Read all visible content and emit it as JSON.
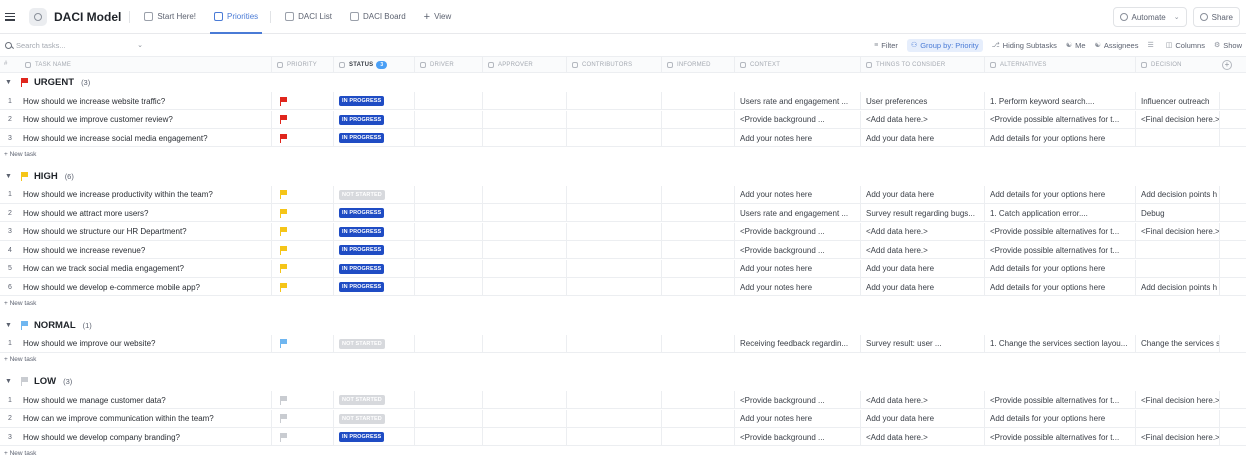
{
  "window": {
    "title": "DACI Model",
    "tabs": [
      {
        "label": "Start Here!",
        "active": false
      },
      {
        "label": "Priorities",
        "active": true
      },
      {
        "label": "DACI List",
        "active": false
      },
      {
        "label": "DACI Board",
        "active": false
      }
    ],
    "add_view": "View",
    "automate": "Automate",
    "share": "Share"
  },
  "toolbar": {
    "search_placeholder": "Search tasks...",
    "filter": "Filter",
    "group_by": "Group by: Priority",
    "hiding_subtasks": "Hiding Subtasks",
    "me": "Me",
    "assignees": "Assignees",
    "columns": "Columns",
    "show": "Show"
  },
  "columns": {
    "hash": "#",
    "task_name": "TASK NAME",
    "priority": "PRIORITY",
    "status": "STATUS",
    "status_count": "3",
    "driver": "DRIVER",
    "approver": "APPROVER",
    "contributors": "CONTRIBUTORS",
    "informed": "INFORMED",
    "context": "CONTEXT",
    "things": "THINGS TO CONSIDER",
    "alternatives": "ALTERNATIVES",
    "decision": "DECISION"
  },
  "colors": {
    "urgent": "#e0261d",
    "high": "#f5c518",
    "normal": "#6fb6f0",
    "low": "#c9ccd1",
    "in_progress": "#1f4cc4",
    "not_started": "#d7d9dd"
  },
  "new_task_label": "+ New task",
  "groups": [
    {
      "name": "URGENT",
      "count": "(3)",
      "flag": "urgent",
      "rows": [
        {
          "idx": "1",
          "name": "How should we increase website traffic?",
          "status": "IN PROGRESS",
          "context": "Users rate and engagement ...",
          "things": "User preferences",
          "alts": "1. Perform keyword search....",
          "decision": "Influencer outreach"
        },
        {
          "idx": "2",
          "name": "How should we improve customer review?",
          "status": "IN PROGRESS",
          "context": "<Provide background ...",
          "things": "<Add data here.>",
          "alts": "<Provide possible alternatives for t...",
          "decision": "<Final decision here.>"
        },
        {
          "idx": "3",
          "name": "How should we increase social media engagement?",
          "status": "IN PROGRESS",
          "context": "Add your notes here",
          "things": "Add your data here",
          "alts": "Add details for your options here",
          "decision": ""
        }
      ]
    },
    {
      "name": "HIGH",
      "count": "(6)",
      "flag": "high",
      "rows": [
        {
          "idx": "1",
          "name": "How should we increase productivity within the team?",
          "status": "NOT STARTED",
          "context": "Add your notes here",
          "things": "Add your data here",
          "alts": "Add details for your options here",
          "decision": "Add decision points h"
        },
        {
          "idx": "2",
          "name": "How should we attract more users?",
          "status": "IN PROGRESS",
          "context": "Users rate and engagement ...",
          "things": "Survey result regarding bugs...",
          "alts": "1. Catch application error....",
          "decision": "Debug"
        },
        {
          "idx": "3",
          "name": "How should we structure our HR Department?",
          "status": "IN PROGRESS",
          "context": "<Provide background ...",
          "things": "<Add data here.>",
          "alts": "<Provide possible alternatives for t...",
          "decision": "<Final decision here.>"
        },
        {
          "idx": "4",
          "name": "How should we increase revenue?",
          "status": "IN PROGRESS",
          "context": "<Provide background ...",
          "things": "<Add data here.>",
          "alts": "<Provide possible alternatives for t...",
          "decision": ""
        },
        {
          "idx": "5",
          "name": "How can we track social media engagement?",
          "status": "IN PROGRESS",
          "context": "Add your notes here",
          "things": "Add your data here",
          "alts": "Add details for your options here",
          "decision": ""
        },
        {
          "idx": "6",
          "name": "How should we develop e-commerce mobile app?",
          "status": "IN PROGRESS",
          "context": "Add your notes here",
          "things": "Add your data here",
          "alts": "Add details for your options here",
          "decision": "Add decision points h"
        }
      ]
    },
    {
      "name": "NORMAL",
      "count": "(1)",
      "flag": "normal",
      "rows": [
        {
          "idx": "1",
          "name": "How should we improve our website?",
          "status": "NOT STARTED",
          "context": "Receiving feedback regardin...",
          "things": "Survey result: user ...",
          "alts": "1. Change the services section layou...",
          "decision": "Change the services s"
        }
      ]
    },
    {
      "name": "LOW",
      "count": "(3)",
      "flag": "low",
      "rows": [
        {
          "idx": "1",
          "name": "How should we manage customer data?",
          "status": "NOT STARTED",
          "context": "<Provide background ...",
          "things": "<Add data here.>",
          "alts": "<Provide possible alternatives for t...",
          "decision": "<Final decision here.>"
        },
        {
          "idx": "2",
          "name": "How can we improve communication within the team?",
          "status": "NOT STARTED",
          "context": "Add your notes here",
          "things": "Add your data here",
          "alts": "Add details for your options here",
          "decision": ""
        },
        {
          "idx": "3",
          "name": "How should we develop company branding?",
          "status": "IN PROGRESS",
          "context": "<Provide background ...",
          "things": "<Add data here.>",
          "alts": "<Provide possible alternatives for t...",
          "decision": "<Final decision here.>"
        }
      ]
    }
  ]
}
